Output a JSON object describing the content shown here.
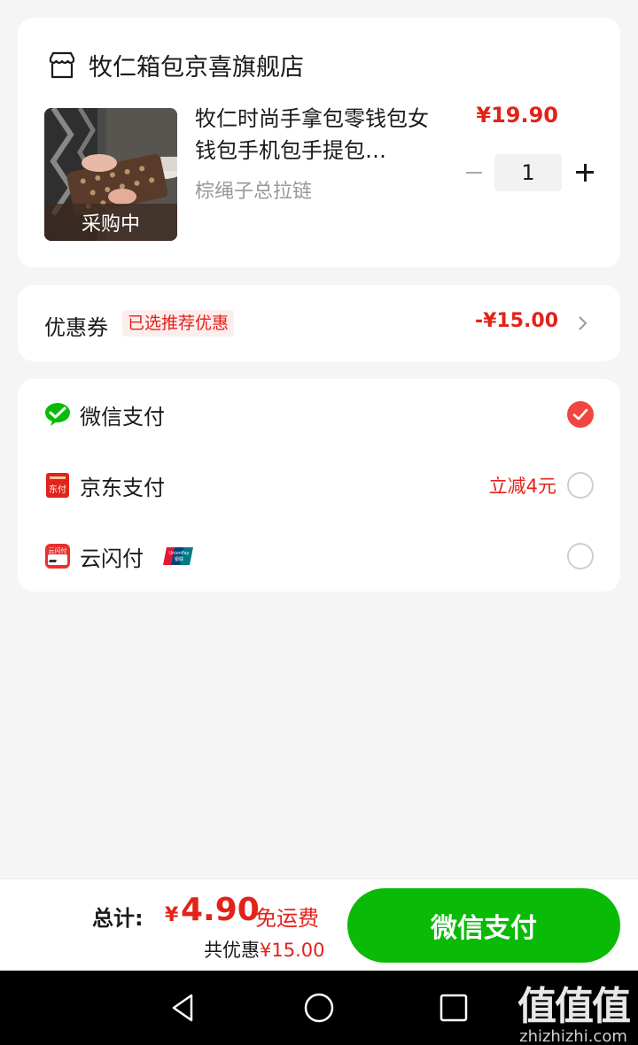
{
  "shop": {
    "name": "牧仁箱包京喜旗舰店"
  },
  "product": {
    "title": "牧仁时尚手拿包零钱包女钱包手机包手提包…",
    "sku": "棕绳子总拉链",
    "price": "¥19.90",
    "badge": "采购中",
    "quantity": "1"
  },
  "coupon": {
    "label": "优惠券",
    "tag": "已选推荐优惠",
    "amount": "-¥15.00"
  },
  "payment_methods": [
    {
      "label": "微信支付",
      "icon": "wechat-pay-icon",
      "selected": true,
      "promo": ""
    },
    {
      "label": "京东支付",
      "icon": "jd-pay-icon",
      "selected": false,
      "promo": "立减4元"
    },
    {
      "label": "云闪付",
      "icon": "cloud-quickpass-icon",
      "selected": false,
      "promo": ""
    }
  ],
  "footer": {
    "total_label": "总计:",
    "currency": "¥",
    "total_amount": "4.90",
    "free_shipping": "免运费",
    "saved_label": "共优惠",
    "saved_amount": "¥15.00",
    "pay_button": "微信支付"
  },
  "watermark": {
    "logo": "值值值",
    "text": "zhizhizhi.com"
  },
  "colors": {
    "price_red": "#e2231a",
    "wechat_green": "#09bb07",
    "selected_radio": "#f0463f"
  }
}
